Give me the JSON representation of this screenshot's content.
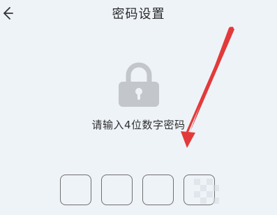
{
  "header": {
    "title": "密码设置",
    "back_icon": "back-arrow-icon"
  },
  "main": {
    "lock_icon": "lock-icon",
    "prompt": "请输入4位数字密码",
    "pin": {
      "length": 4,
      "values": [
        "",
        "",
        "",
        ""
      ]
    }
  },
  "colors": {
    "background": "#eef3f8",
    "lock": "#c3c7cc",
    "annotation_arrow": "#e23a3a",
    "box_border": "#6f6f6f"
  }
}
